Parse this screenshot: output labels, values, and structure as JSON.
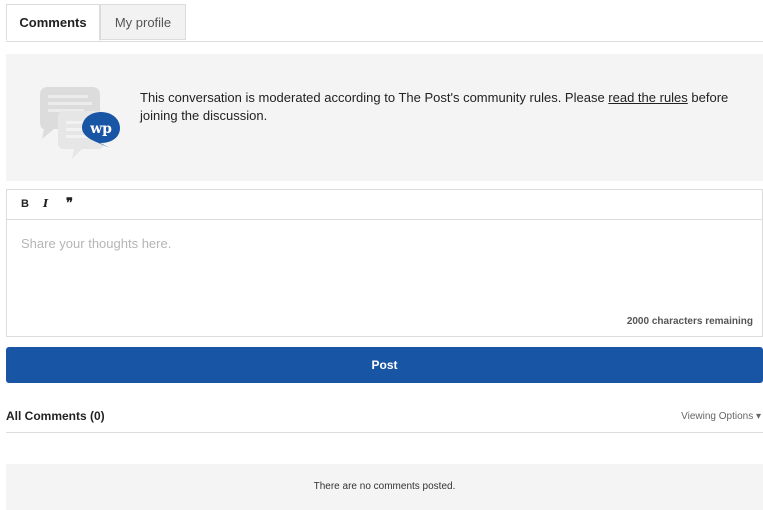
{
  "tabs": [
    {
      "label": "Comments",
      "active": true
    },
    {
      "label": "My profile",
      "active": false
    }
  ],
  "banner": {
    "text_before": "This conversation is moderated according to The Post's community rules. Please ",
    "link_text": "read the rules",
    "text_after": " before joining the discussion.",
    "badge_text": "wp",
    "badge_color": "#1955a5"
  },
  "editor": {
    "toolbar": {
      "bold": "B",
      "italic": "I",
      "quote": "❞"
    },
    "placeholder": "Share your thoughts here.",
    "value": "",
    "chars_remaining": "2000 characters remaining"
  },
  "post_button": {
    "label": "Post",
    "color": "#1955a5"
  },
  "comments": {
    "header": "All Comments (0)",
    "viewing_options": "Viewing Options ▾",
    "empty_message": "There are no comments posted."
  }
}
